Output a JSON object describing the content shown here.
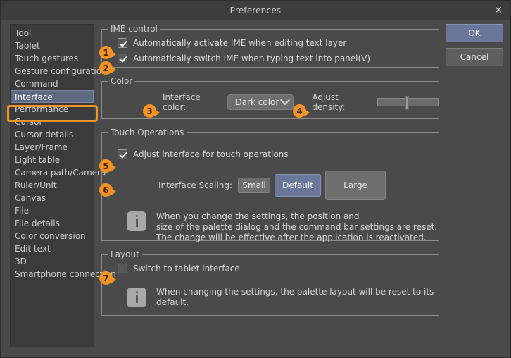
{
  "window": {
    "title": "Preferences",
    "close_icon": "close-icon"
  },
  "actions": {
    "ok_label": "OK",
    "cancel_label": "Cancel"
  },
  "sidebar": {
    "items": [
      {
        "label": "Tool",
        "selected": false
      },
      {
        "label": "Tablet",
        "selected": false
      },
      {
        "label": "Touch gestures",
        "selected": false
      },
      {
        "label": "Gesture configuration",
        "selected": false
      },
      {
        "label": "Command",
        "selected": false
      },
      {
        "label": "Interface",
        "selected": true
      },
      {
        "label": "Performance",
        "selected": false
      },
      {
        "label": "Cursor",
        "selected": false
      },
      {
        "label": "Cursor details",
        "selected": false
      },
      {
        "label": "Layer/Frame",
        "selected": false
      },
      {
        "label": "Light table",
        "selected": false
      },
      {
        "label": "Camera path/Camera",
        "selected": false
      },
      {
        "label": "Ruler/Unit",
        "selected": false
      },
      {
        "label": "Canvas",
        "selected": false
      },
      {
        "label": "File",
        "selected": false
      },
      {
        "label": "File details",
        "selected": false
      },
      {
        "label": "Color conversion",
        "selected": false
      },
      {
        "label": "Edit text",
        "selected": false
      },
      {
        "label": "3D",
        "selected": false
      },
      {
        "label": "Smartphone connection",
        "selected": false
      }
    ]
  },
  "ime_control": {
    "legend": "IME control",
    "auto_activate": {
      "label": "Automatically activate IME when editing text layer",
      "checked": true,
      "badge": "1"
    },
    "auto_switch": {
      "label": "Automatically switch IME when typing text into panel(V)",
      "checked": true,
      "badge": "2"
    }
  },
  "color": {
    "legend": "Color",
    "interface_color_label": "Interface color:",
    "interface_color_value": "Dark color",
    "interface_color_badge": "3",
    "chevron_icon": "chevron-down-icon",
    "adjust_density_label": "Adjust density:",
    "adjust_density_badge": "4",
    "adjust_density_percent": 55
  },
  "touch_operations": {
    "legend": "Touch Operations",
    "adjust_interface": {
      "label": "Adjust interface for touch operations",
      "checked": true,
      "badge": "5"
    },
    "scaling_label": "Interface Scaling:",
    "scaling_badge": "6",
    "scaling_options": [
      {
        "label": "Small",
        "selected": false
      },
      {
        "label": "Default",
        "selected": true
      },
      {
        "label": "Large",
        "selected": false
      }
    ],
    "info_icon": "info-icon",
    "info_text": "When you change the settings, the position and\nsize of the palette dialog and the command bar settings are reset.\nThe change will be effective after the application is reactivated."
  },
  "layout": {
    "legend": "Layout",
    "switch_tablet": {
      "label": "Switch to tablet interface",
      "checked": false,
      "badge": "7"
    },
    "info_icon": "info-icon",
    "info_text": "When changing the settings, the palette layout will be reset to its default."
  },
  "colors": {
    "accent_orange": "#f39322",
    "selection_blue": "#6a769a",
    "dialog_bg": "#4a4a4a",
    "sidebar_bg": "#3b3b3b"
  }
}
